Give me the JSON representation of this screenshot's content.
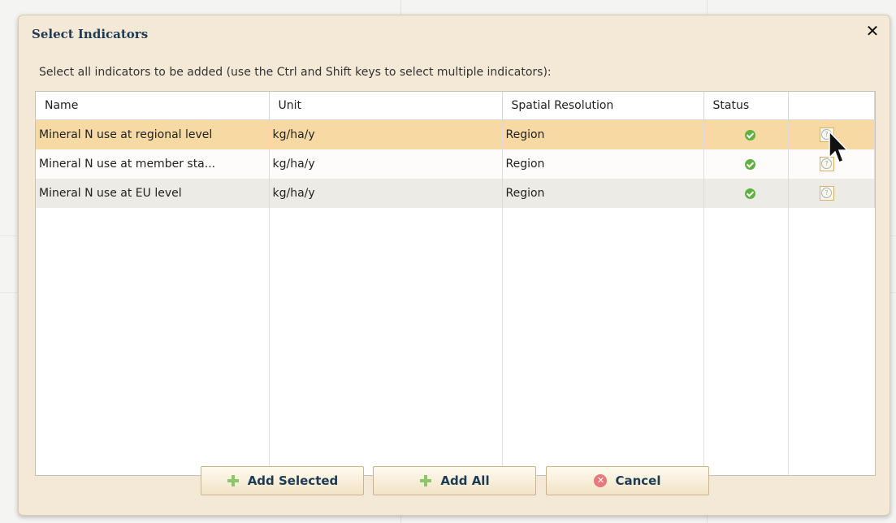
{
  "dialog": {
    "title": "Select Indicators",
    "close_glyph": "✕",
    "instruction": "Select all indicators to be added (use the Ctrl and Shift keys to select multiple indicators):"
  },
  "table": {
    "columns": [
      "Name",
      "Unit",
      "Spatial Resolution",
      "Status",
      ""
    ],
    "rows": [
      {
        "name": "Mineral N use at regional level",
        "unit": "kg/ha/y",
        "resolution": "Region",
        "status_icon": "check-circle-icon",
        "selected": true
      },
      {
        "name": "Mineral N use at member sta...",
        "unit": "kg/ha/y",
        "resolution": "Region",
        "status_icon": "check-circle-icon",
        "selected": false
      },
      {
        "name": "Mineral N use at EU level",
        "unit": "kg/ha/y",
        "resolution": "Region",
        "status_icon": "check-circle-icon",
        "selected": false
      }
    ]
  },
  "buttons": {
    "add_selected": "Add Selected",
    "add_all": "Add All",
    "cancel": "Cancel"
  },
  "colors": {
    "selected_row": "#f6d9a3",
    "dialog_bg": "#f3e9d6",
    "title_text": "#1d3b55",
    "status_ok": "#5fb142"
  }
}
